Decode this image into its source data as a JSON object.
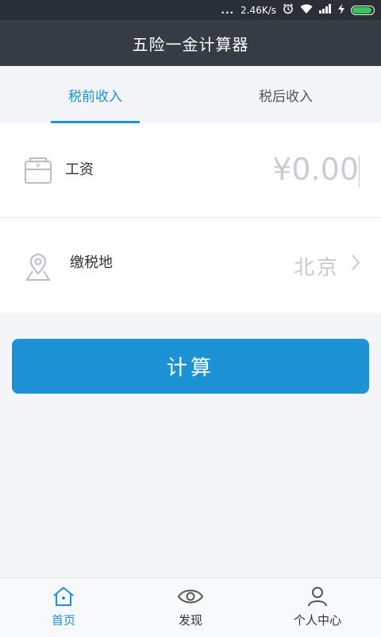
{
  "status_bar": {
    "dots": "...",
    "network_speed": "2.46K/s",
    "icons": [
      "alarm-icon",
      "wifi-icon",
      "signal-icon",
      "charging-icon",
      "battery-icon"
    ]
  },
  "app_bar": {
    "title": "五险一金计算器"
  },
  "tabs": [
    {
      "label": "税前收入",
      "active": true
    },
    {
      "label": "税后收入",
      "active": false
    }
  ],
  "form": {
    "salary": {
      "label": "工资",
      "placeholder": "¥0.00",
      "icon": "wallet-icon"
    },
    "tax_location": {
      "label": "缴税地",
      "value": "北京",
      "icon": "map-pin-icon"
    }
  },
  "calculate_button": {
    "label": "计算"
  },
  "bottom_nav": [
    {
      "label": "首页",
      "icon": "home-icon",
      "active": true
    },
    {
      "label": "发现",
      "icon": "eye-icon",
      "active": false
    },
    {
      "label": "个人中心",
      "icon": "user-icon",
      "active": false
    }
  ],
  "colors": {
    "accent": "#1e93d3",
    "app_bar": "#353c44",
    "status_bar": "#2a2f35"
  }
}
